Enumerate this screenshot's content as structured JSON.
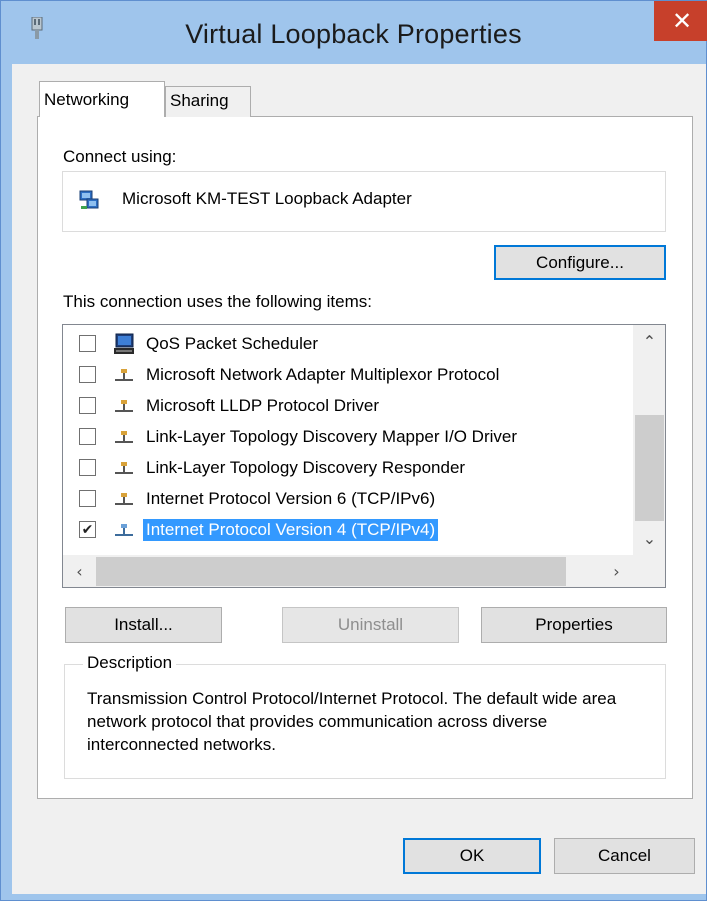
{
  "window": {
    "title": "Virtual Loopback Properties",
    "close_glyph": "✕"
  },
  "tabs": [
    {
      "label": "Networking",
      "active": true
    },
    {
      "label": "Sharing",
      "active": false
    }
  ],
  "connect": {
    "label": "Connect using:",
    "adapter_name": "Microsoft KM-TEST Loopback Adapter",
    "configure_label": "Configure..."
  },
  "items": {
    "label": "This connection uses the following items:",
    "list": [
      {
        "label": "QoS Packet Scheduler",
        "checked": false,
        "icon": "qos-computer-icon"
      },
      {
        "label": "Microsoft Network Adapter Multiplexor Protocol",
        "checked": false,
        "icon": "network-protocol-icon"
      },
      {
        "label": "Microsoft LLDP Protocol Driver",
        "checked": false,
        "icon": "network-protocol-icon"
      },
      {
        "label": "Link-Layer Topology Discovery Mapper I/O Driver",
        "checked": false,
        "icon": "network-protocol-icon"
      },
      {
        "label": "Link-Layer Topology Discovery Responder",
        "checked": false,
        "icon": "network-protocol-icon"
      },
      {
        "label": "Internet Protocol Version 6 (TCP/IPv6)",
        "checked": false,
        "icon": "network-protocol-icon"
      },
      {
        "label": "Internet Protocol Version 4 (TCP/IPv4)",
        "checked": true,
        "selected": true,
        "icon": "network-protocol-icon"
      }
    ],
    "checkmark_glyph": "✔"
  },
  "buttons": {
    "install": "Install...",
    "uninstall": "Uninstall",
    "properties": "Properties",
    "ok": "OK",
    "cancel": "Cancel"
  },
  "description": {
    "legend": "Description",
    "text": "Transmission Control Protocol/Internet Protocol. The default wide area network protocol that provides communication across diverse interconnected networks."
  },
  "scroll": {
    "up": "⌃",
    "down": "⌄",
    "left": "‹",
    "right": "›"
  },
  "colors": {
    "selection": "#3399ff",
    "close_button": "#c7402b",
    "frame": "#9fc5ec"
  }
}
